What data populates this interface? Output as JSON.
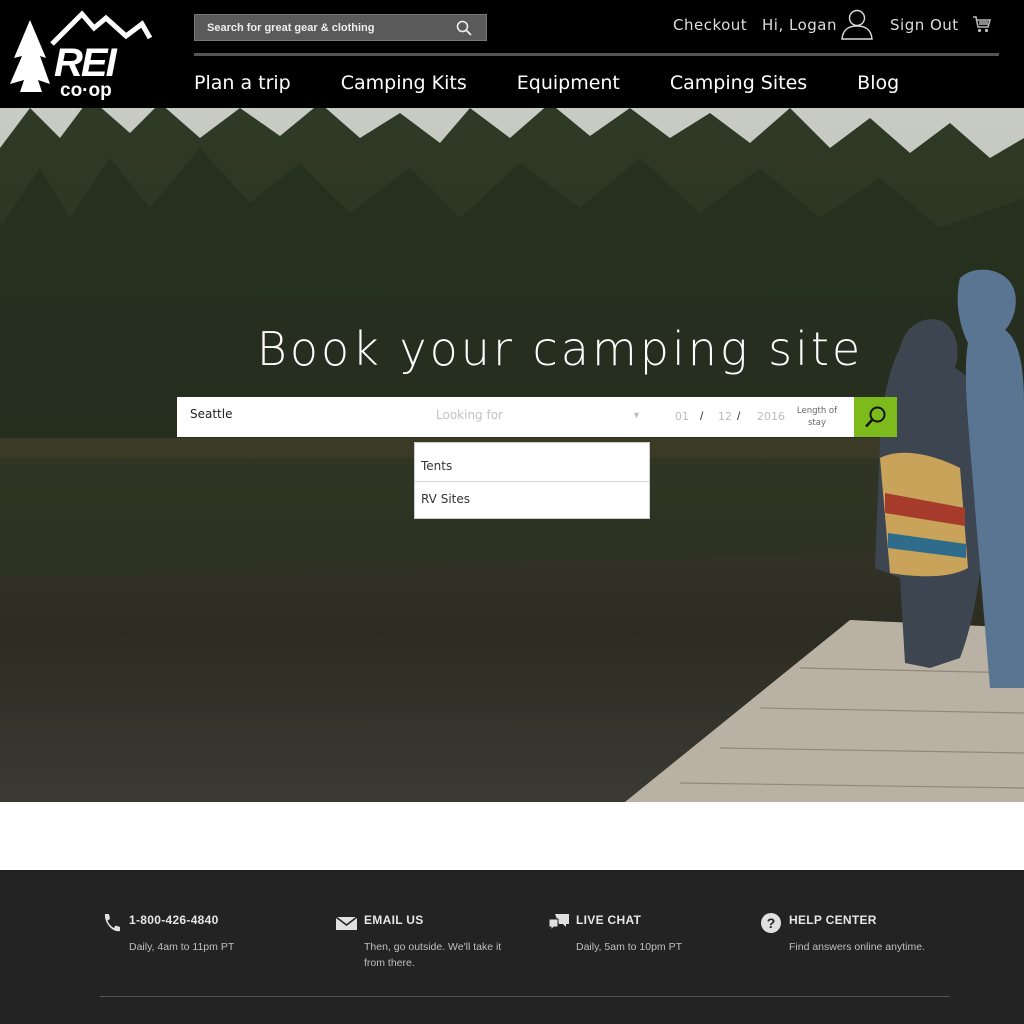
{
  "brand": {
    "logo_text": "REI",
    "logo_subtext": "co·op"
  },
  "header": {
    "search_placeholder": "Search for great gear & clothing",
    "checkout": "Checkout",
    "greeting": "Hi, Logan",
    "sign_out": "Sign Out",
    "nav": [
      "Plan a trip",
      "Camping Kits",
      "Equipment",
      "Camping Sites",
      "Blog"
    ]
  },
  "hero": {
    "title": "Book your camping site",
    "location_value": "Seattle",
    "looking_for_placeholder": "Looking for",
    "date_month": "01",
    "date_day": "12",
    "date_year": "2016",
    "date_separator": "/",
    "length_of_stay": "Length of stay",
    "dropdown_options": [
      "Tents",
      "RV Sites"
    ]
  },
  "footer": {
    "contacts": [
      {
        "icon": "phone-icon",
        "title": "1-800-426-4840",
        "desc": "Daily, 4am to 11pm PT"
      },
      {
        "icon": "envelope-icon",
        "title": "EMAIL US",
        "desc": "Then, go outside. We'll take it from there."
      },
      {
        "icon": "chat-icon",
        "title": "LIVE CHAT",
        "desc": "Daily, 5am to 10pm PT"
      },
      {
        "icon": "help-icon",
        "title": "HELP CENTER",
        "desc": "Find answers online anytime."
      }
    ]
  },
  "colors": {
    "header_bg": "#000000",
    "accent_green": "#7dbb1d",
    "footer_bg": "#232323"
  }
}
